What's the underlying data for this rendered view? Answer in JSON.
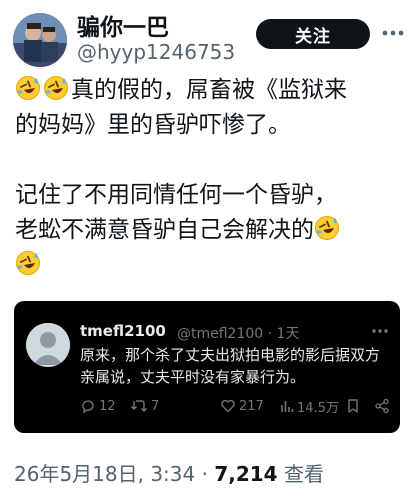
{
  "author": {
    "display_name": "骗你一巴",
    "handle": "@hyyp1246753",
    "follow_label": "关注"
  },
  "post": {
    "line1": "真的假的，屌畜被《监狱来",
    "line2": "的妈妈》里的昏驴吓惨了。",
    "line3": "记住了不用同情任何一个昏驴，",
    "line4": "老蚣不满意昏驴自己会解决的",
    "emoji": "rolling-on-floor-laughing"
  },
  "quoted": {
    "name": "tmefl2100",
    "meta": "@tmefl2100 · 1天",
    "text": "原来，那个杀了丈夫出狱拍电影的影后据双方亲属说，丈夫平时没有家暴行为。",
    "replies": "12",
    "retweets": "7",
    "likes": "217",
    "views": "14.5万"
  },
  "footer": {
    "date": "26年5月18日, 3:34 · ",
    "views_count": "7,214",
    "views_label": " 查看"
  }
}
